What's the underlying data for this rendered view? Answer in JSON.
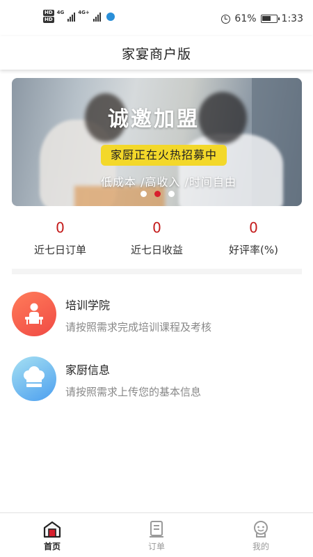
{
  "status_bar": {
    "network_badges": [
      "HD",
      "HD"
    ],
    "signal_labels": [
      "4G",
      "4G+"
    ],
    "battery": "61%",
    "time": "1:33",
    "icons": [
      "alarm-icon",
      "battery-icon",
      "signal-icon",
      "app-notification-icon"
    ]
  },
  "header": {
    "title": "家宴商户版"
  },
  "banner": {
    "headline": "诚邀加盟",
    "tag": "家厨正在火热招募中",
    "subtitle": "低成本 /高收入 /时间自由",
    "slide_count": 3,
    "active_slide": 2
  },
  "stats": [
    {
      "value": "0",
      "label": "近七日订单"
    },
    {
      "value": "0",
      "label": "近七日收益"
    },
    {
      "value": "0",
      "label": "好评率(%)"
    }
  ],
  "menu": [
    {
      "title": "培训学院",
      "desc": "请按照需求完成培训课程及考核",
      "icon": "training-icon",
      "color": "#f04a44"
    },
    {
      "title": "家厨信息",
      "desc": "请按照需求上传您的基本信息",
      "icon": "chef-hat-icon",
      "color": "#4c9fef"
    }
  ],
  "tabs": [
    {
      "label": "首页",
      "icon": "home-icon",
      "active": true
    },
    {
      "label": "订单",
      "icon": "order-icon",
      "active": false
    },
    {
      "label": "我的",
      "icon": "profile-icon",
      "active": false
    }
  ],
  "colors": {
    "accent_red": "#d8202e",
    "stat_red": "#c41a1a",
    "banner_tag_yellow": "#f3d82a"
  }
}
